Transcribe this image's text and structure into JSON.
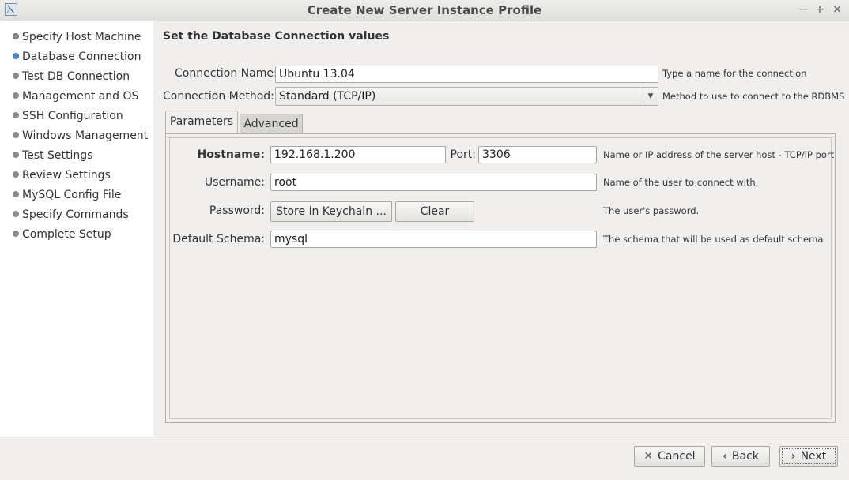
{
  "window": {
    "title": "Create New Server Instance Profile",
    "controls": {
      "minimize": "−",
      "maximize": "+",
      "close": "×"
    }
  },
  "sidebar": {
    "steps": [
      {
        "label": "Specify Host Machine",
        "state": "done"
      },
      {
        "label": "Database Connection",
        "state": "current"
      },
      {
        "label": "Test DB Connection",
        "state": "pending"
      },
      {
        "label": "Management and OS",
        "state": "pending"
      },
      {
        "label": "SSH Configuration",
        "state": "pending"
      },
      {
        "label": "Windows Management",
        "state": "pending"
      },
      {
        "label": "Test Settings",
        "state": "pending"
      },
      {
        "label": "Review Settings",
        "state": "pending"
      },
      {
        "label": "MySQL Config File",
        "state": "pending"
      },
      {
        "label": "Specify Commands",
        "state": "pending"
      },
      {
        "label": "Complete Setup",
        "state": "pending"
      }
    ]
  },
  "main": {
    "heading": "Set the Database Connection values",
    "connection_name": {
      "label": "Connection Name:",
      "value": "Ubuntu 13.04",
      "hint": "Type a name for the connection"
    },
    "connection_method": {
      "label": "Connection Method:",
      "value": "Standard (TCP/IP)",
      "hint": "Method to use to connect to the RDBMS"
    },
    "tabs": [
      {
        "label": "Parameters",
        "active": true
      },
      {
        "label": "Advanced",
        "active": false
      }
    ],
    "parameters": {
      "hostname": {
        "label": "Hostname:",
        "value": "192.168.1.200"
      },
      "port": {
        "label": "Port:",
        "value": "3306",
        "hint": "Name or IP address of the server host - TCP/IP port"
      },
      "username": {
        "label": "Username:",
        "value": "root",
        "hint": "Name of the user to connect with."
      },
      "password": {
        "label": "Password:",
        "store_button": "Store in Keychain ...",
        "clear_button": "Clear",
        "hint": "The user's password."
      },
      "default_schema": {
        "label": "Default Schema:",
        "value": "mysql",
        "hint": "The schema that will be used as default schema"
      }
    }
  },
  "footer": {
    "cancel": "Cancel",
    "back": "Back",
    "next": "Next",
    "cancel_icon": "✕",
    "back_icon": "‹",
    "next_icon": "›"
  },
  "colors": {
    "current_step": "#4a86c8",
    "sidebar_bg": "#ffffff",
    "window_bg": "#f0efed"
  }
}
